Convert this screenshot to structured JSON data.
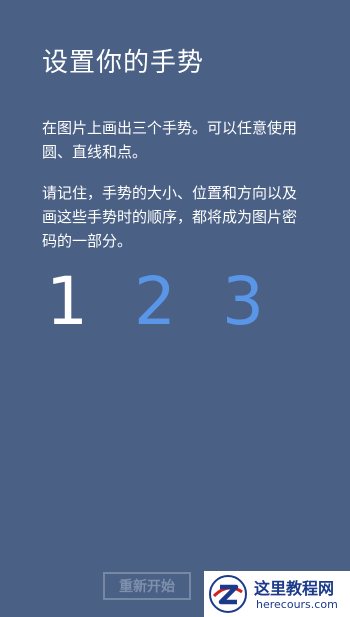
{
  "page": {
    "title": "设置你的手势",
    "instruction_1": "在图片上画出三个手势。可以任意使用圆、直线和点。",
    "instruction_2": "请记住，手势的大小、位置和方向以及画这些手势时的顺序，都将成为图片密码的一部分。"
  },
  "steps": [
    {
      "label": "1",
      "state": "current"
    },
    {
      "label": "2",
      "state": "pending"
    },
    {
      "label": "3",
      "state": "pending"
    }
  ],
  "buttons": {
    "restart_label": "重新开始"
  },
  "watermark": {
    "site_name": "这里教程网",
    "site_url": "herecours.com"
  },
  "colors": {
    "background": "#4a6085",
    "active_step": "#ffffff",
    "pending_step": "#5a96e8"
  }
}
